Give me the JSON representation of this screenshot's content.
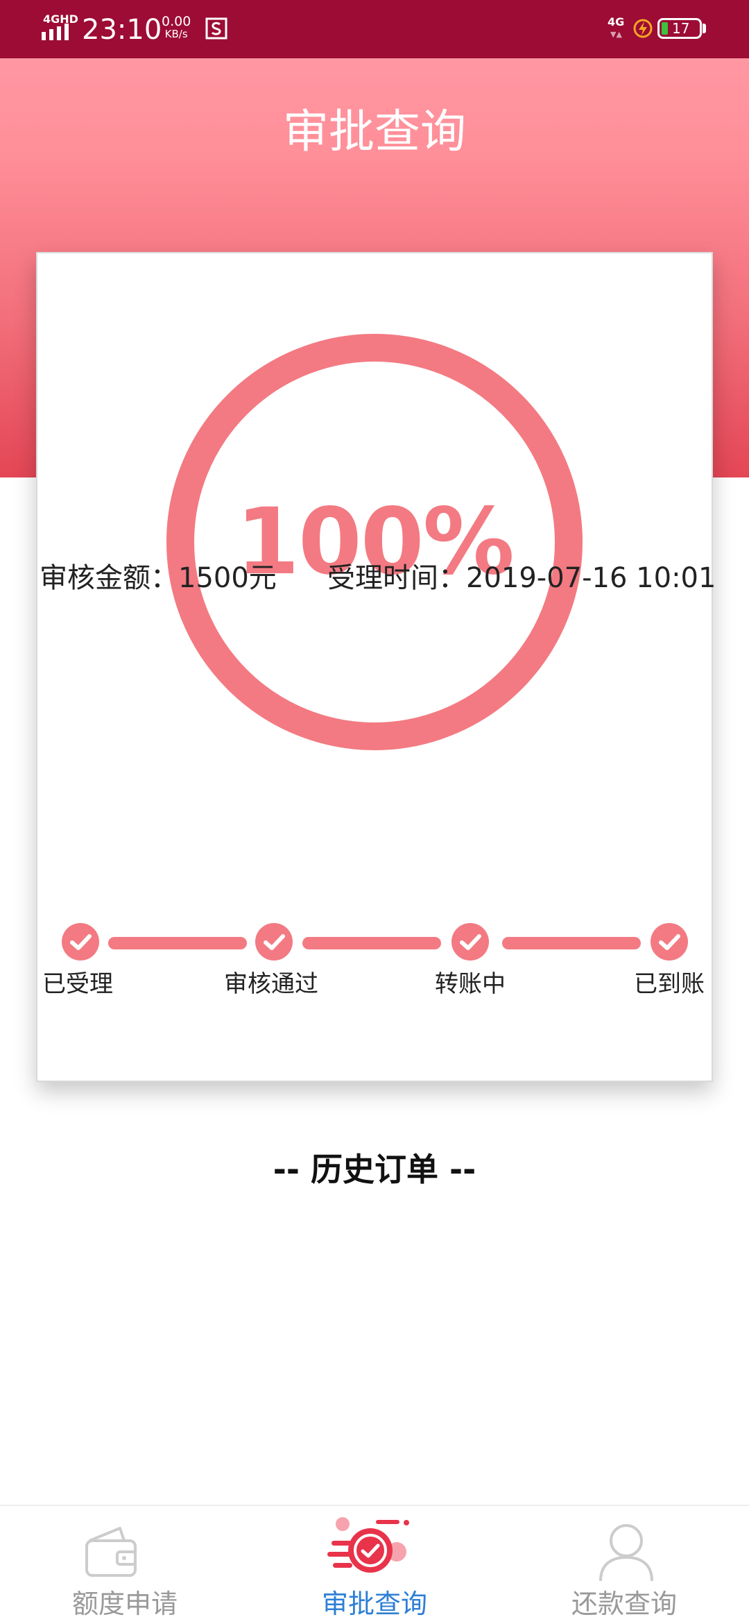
{
  "status_bar": {
    "network_label": "4GHD",
    "time": "23:10",
    "speed_value": "0.00",
    "speed_unit": "KB/s",
    "network_right": "4G",
    "battery_level": "17",
    "battery_fill_percent": 17,
    "background_color": "#9c0c34"
  },
  "header": {
    "title": "审批查询"
  },
  "progress": {
    "percent_value": 100,
    "percent_text": "100%",
    "ring_color": "#f37a82"
  },
  "info": {
    "amount_text": "审核金额：1500元",
    "time_text": "受理时间：2019-07-16 10:01"
  },
  "steps": [
    {
      "label": "已受理",
      "done": true
    },
    {
      "label": "审核通过",
      "done": true
    },
    {
      "label": "转账中",
      "done": true
    },
    {
      "label": "已到账",
      "done": true
    }
  ],
  "history": {
    "title": "-- 历史订单 --"
  },
  "tabbar": {
    "items": [
      {
        "label": "额度申请",
        "icon": "wallet-icon",
        "active": false
      },
      {
        "label": "审批查询",
        "icon": "approval-check-icon",
        "active": true
      },
      {
        "label": "还款查询",
        "icon": "user-icon",
        "active": false
      }
    ],
    "active_color": "#2d7fd4",
    "inactive_color": "#999999"
  }
}
